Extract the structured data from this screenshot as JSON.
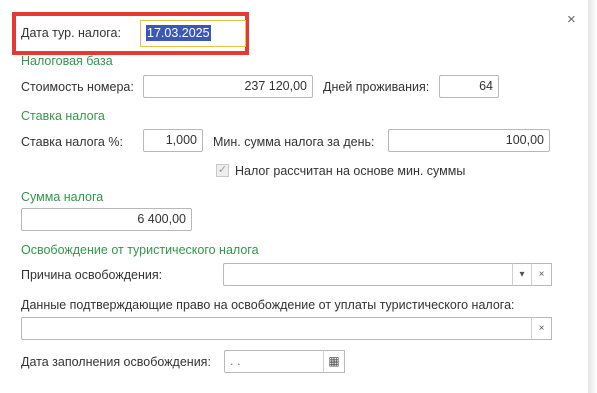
{
  "dialog": {
    "close_glyph": "×"
  },
  "tax_date": {
    "label": "Дата тур. налога:",
    "value": "17.03.2025"
  },
  "tax_base": {
    "section_title": "Налоговая база",
    "room_cost_label": "Стоимость номера:",
    "room_cost_value": "237 120,00",
    "days_label": "Дней проживания:",
    "days_value": "64"
  },
  "tax_rate": {
    "section_title": "Ставка налога",
    "rate_label": "Ставка налога %:",
    "rate_value": "1,000",
    "min_label": "Мин. сумма налога за день:",
    "min_value": "100,00",
    "checkbox_label": "Налог рассчитан на основе мин. суммы",
    "checkbox_checked": true,
    "checkbox_glyph": "✓"
  },
  "tax_sum": {
    "section_title": "Сумма налога",
    "value": "6 400,00"
  },
  "exemption": {
    "section_title": "Освобождение от туристического налога",
    "reason_label": "Причина освобождения:",
    "reason_value": "",
    "dropdown_glyph": "▾",
    "clear_glyph": "×",
    "evidence_label": "Данные подтверждающие право на освобождение от уплаты туристического налога:",
    "evidence_value": "",
    "fill_date_label": "Дата заполнения освобождения:",
    "fill_date_value": " .  .",
    "calendar_glyph": "▦"
  },
  "colors": {
    "section_green": "#31974d",
    "highlight_red": "#e53935",
    "selection_blue": "#3d57b8"
  }
}
